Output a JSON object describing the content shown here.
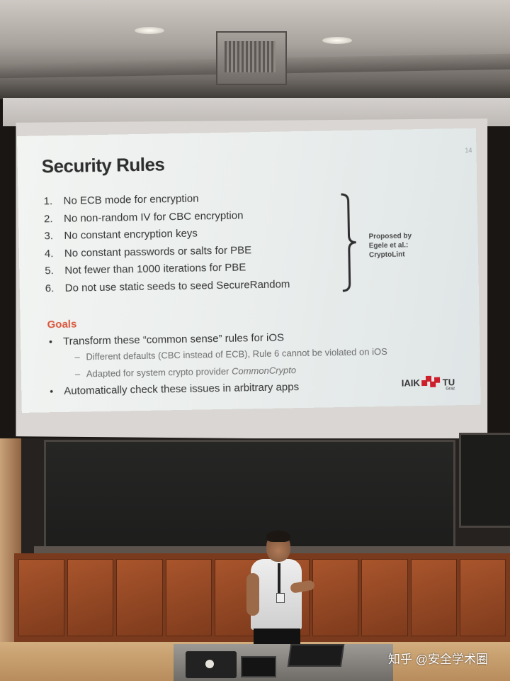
{
  "slide": {
    "number": "14",
    "title": "Security Rules",
    "rules": [
      {
        "num": "1.",
        "text": "No ECB mode for encryption"
      },
      {
        "num": "2.",
        "text": "No non-random IV for CBC encryption"
      },
      {
        "num": "3.",
        "text": "No constant encryption keys"
      },
      {
        "num": "4.",
        "text": "No constant passwords or salts for PBE"
      },
      {
        "num": "5.",
        "text": "Not fewer than 1000 iterations for PBE"
      },
      {
        "num": "6.",
        "text": "Do not use static seeds to seed SecureRandom"
      }
    ],
    "brace_note": [
      "Proposed by",
      "Egele et al.:",
      "CryptoLint"
    ],
    "goals_title": "Goals",
    "goal_1": "Transform these “common sense” rules for iOS",
    "sub_1": "Different defaults (CBC instead of ECB), Rule 6 cannot be violated on iOS",
    "sub_2_prefix": "Adapted for system crypto provider ",
    "sub_2_em": "CommonCrypto",
    "goal_2": "Automatically check these issues in arbitrary apps",
    "logo_left": "IAIK",
    "logo_right": "TU",
    "logo_sub": "Graz"
  },
  "bullet_glyph": "•",
  "dash_glyph": "–",
  "watermark": "知乎 @安全学术圈",
  "colors": {
    "accent_goals": "#d9573b",
    "logo_red": "#cc1f2b"
  }
}
